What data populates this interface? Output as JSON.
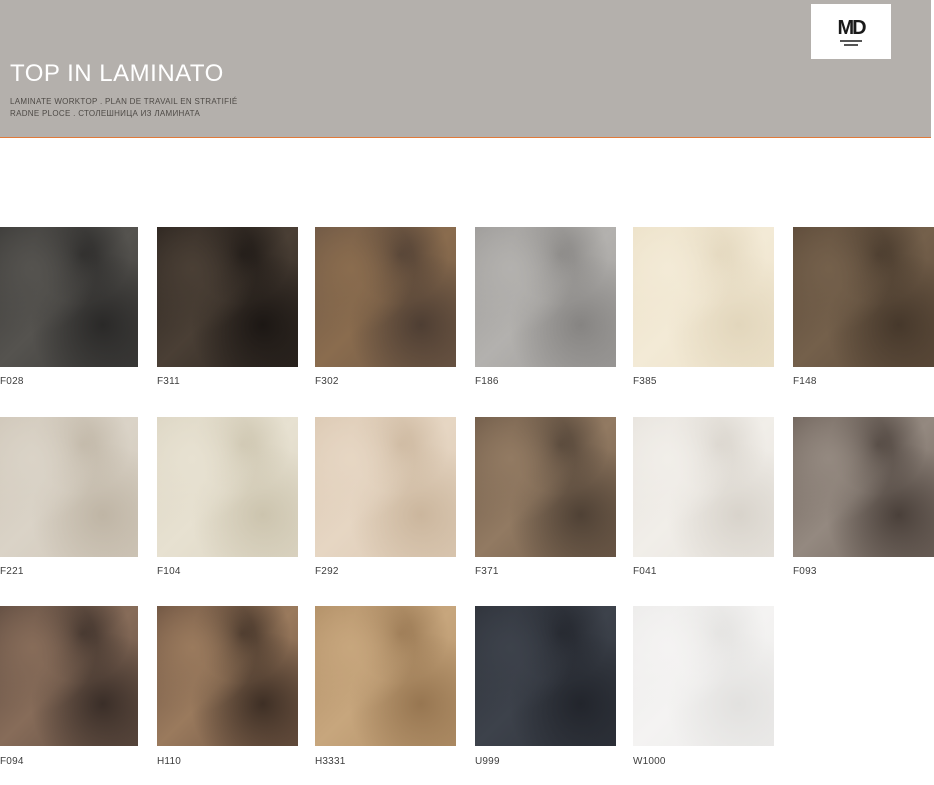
{
  "header": {
    "title": "TOP IN LAMINATO",
    "subtitle_line1": "LAMINATE WORKTOP . PLAN DE TRAVAIL EN STRATIFIÉ",
    "subtitle_line2": "RADNE PLOCE . СТОЛЕШНИЦА ИЗ ЛАМИНАТА",
    "accent_color": "#e07a3a",
    "background_color": "#b4b0ac"
  },
  "logo": {
    "text": "MD",
    "icon": "brand-logo"
  },
  "swatches": [
    {
      "code": "F028",
      "colors": [
        "#3b3a38",
        "#55534f",
        "#2a2928"
      ]
    },
    {
      "code": "F311",
      "colors": [
        "#2b241f",
        "#4a3f35",
        "#1c1714"
      ]
    },
    {
      "code": "F302",
      "colors": [
        "#6d5745",
        "#8a6c4e",
        "#4e3e33"
      ]
    },
    {
      "code": "F186",
      "colors": [
        "#9c9a98",
        "#b3b1ae",
        "#868482"
      ]
    },
    {
      "code": "F385",
      "colors": [
        "#ece1c8",
        "#f3ead6",
        "#e2d6bc"
      ]
    },
    {
      "code": "F148",
      "colors": [
        "#5c4a39",
        "#74604b",
        "#46382b"
      ]
    },
    {
      "code": "F221",
      "colors": [
        "#cfc6b8",
        "#dad3c7",
        "#bfb5a5"
      ]
    },
    {
      "code": "F104",
      "colors": [
        "#dcd5c3",
        "#e7e1d1",
        "#ccc4ae"
      ]
    },
    {
      "code": "F292",
      "colors": [
        "#dbc8b2",
        "#e6d6c3",
        "#cbb69d"
      ]
    },
    {
      "code": "F371",
      "colors": [
        "#6e5a48",
        "#927a62",
        "#4f4135"
      ]
    },
    {
      "code": "F041",
      "colors": [
        "#e7e3dd",
        "#f1eee9",
        "#d8d3cb"
      ]
    },
    {
      "code": "F093",
      "colors": [
        "#6e625a",
        "#948980",
        "#4a403a"
      ]
    },
    {
      "code": "F094",
      "colors": [
        "#5d4a3f",
        "#876c59",
        "#3a2e28"
      ]
    },
    {
      "code": "H110",
      "colors": [
        "#6b5140",
        "#9a7a5d",
        "#3e2f25"
      ]
    },
    {
      "code": "H3331",
      "colors": [
        "#b08e66",
        "#c7a67d",
        "#977651"
      ]
    },
    {
      "code": "U999",
      "colors": [
        "#2e323a",
        "#3d424b",
        "#22252c"
      ]
    },
    {
      "code": "W1000",
      "colors": [
        "#ecebea",
        "#f4f3f2",
        "#e2e1df"
      ]
    }
  ]
}
